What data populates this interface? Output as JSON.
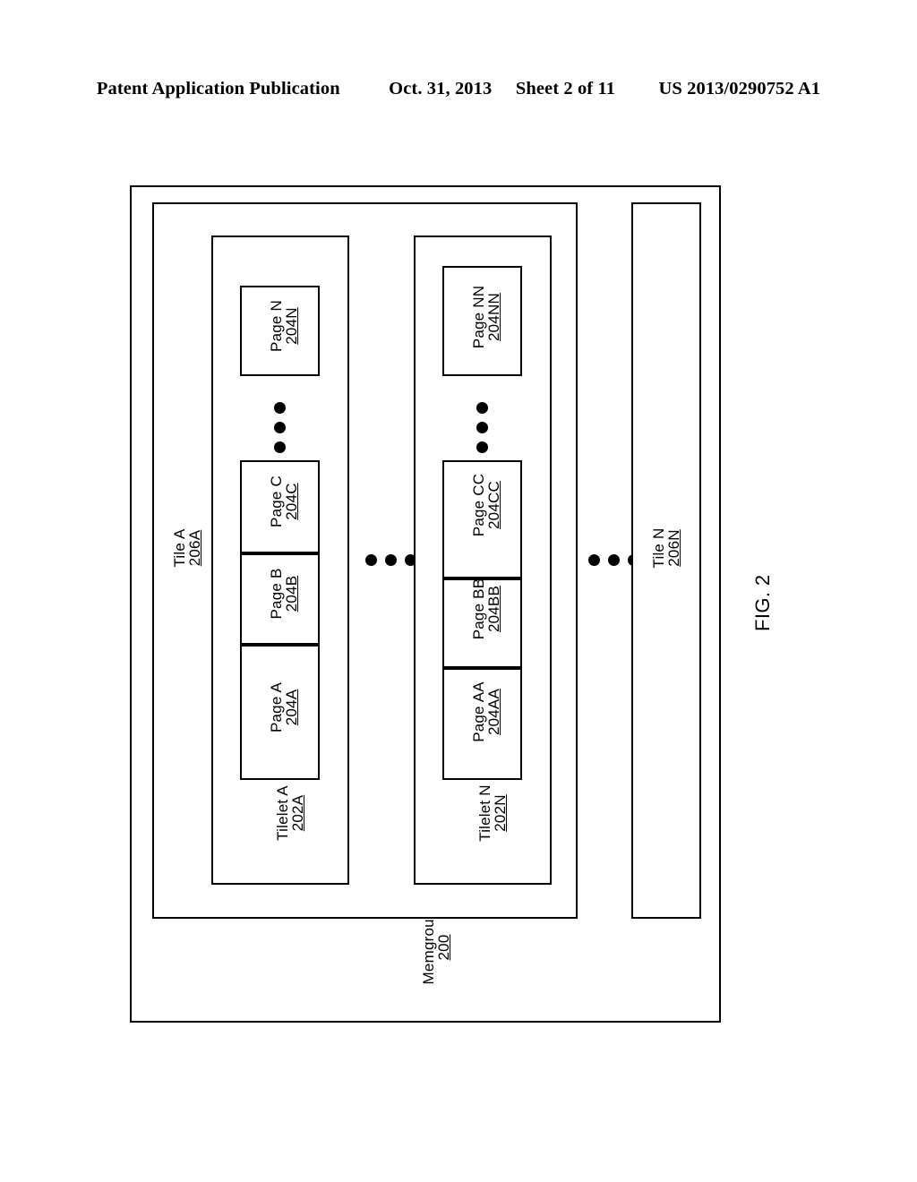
{
  "header": {
    "publication": "Patent Application Publication",
    "date": "Oct. 31, 2013",
    "sheet": "Sheet 2 of 11",
    "patent_number": "US 2013/0290752 A1"
  },
  "figure": {
    "caption": "FIG. 2"
  },
  "diagram": {
    "memgroup": {
      "name": "Memgroup",
      "ref": "200"
    },
    "tiles": [
      {
        "name": "Tile A",
        "ref": "206A"
      },
      {
        "name": "Tile N",
        "ref": "206N"
      }
    ],
    "tilelets": [
      {
        "name": "Tilelet A",
        "ref": "202A"
      },
      {
        "name": "Tilelet N",
        "ref": "202N"
      }
    ],
    "pages_tilelet_a": [
      {
        "name": "Page A",
        "ref": "204A"
      },
      {
        "name": "Page B",
        "ref": "204B"
      },
      {
        "name": "Page C",
        "ref": "204C"
      },
      {
        "name": "Page N",
        "ref": "204N"
      }
    ],
    "pages_tilelet_n": [
      {
        "name": "Page AA",
        "ref": "204AA"
      },
      {
        "name": "Page BB",
        "ref": "204BB"
      },
      {
        "name": "Page CC",
        "ref": "204CC"
      },
      {
        "name": "Page NN",
        "ref": "204NN"
      }
    ],
    "ellipses": [
      {
        "id": "pages-a-ellipsis",
        "orientation": "vertical",
        "count": 3
      },
      {
        "id": "pages-n-ellipsis",
        "orientation": "vertical",
        "count": 3
      },
      {
        "id": "tilelet-ellipsis",
        "orientation": "horizontal",
        "count": 3
      },
      {
        "id": "tile-ellipsis",
        "orientation": "horizontal",
        "count": 3
      }
    ],
    "colors": {
      "line": "#000000",
      "background": "#ffffff"
    }
  }
}
